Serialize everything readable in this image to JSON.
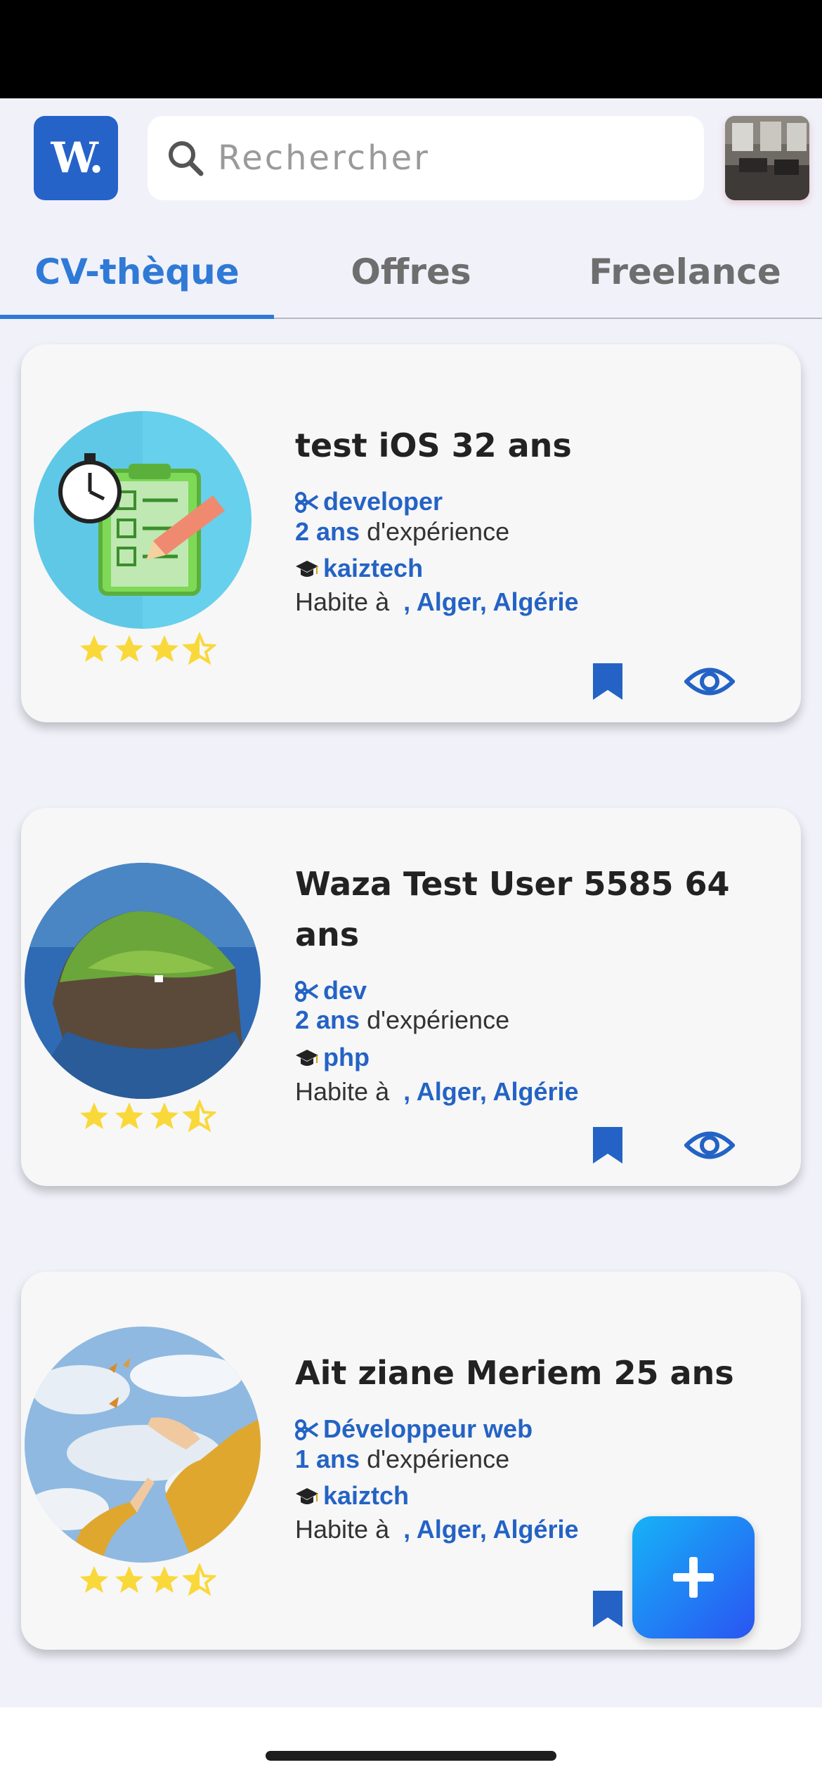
{
  "header": {
    "logo_text": "W.",
    "search_placeholder": "Rechercher"
  },
  "tabs": [
    {
      "label": "CV-thèque",
      "active": true
    },
    {
      "label": "Offres",
      "active": false
    },
    {
      "label": "Freelance",
      "active": false
    }
  ],
  "cards": [
    {
      "name": "test iOS 32 ans",
      "job": "developer",
      "experience_value": "2 ans",
      "experience_suffix": "d'expérience",
      "school": "kaiztech",
      "lives_prefix": "Habite à",
      "location": ", Alger, Algérie",
      "rating": 3.5
    },
    {
      "name": "Waza Test User 5585 64 ans",
      "job": "dev",
      "experience_value": "2 ans",
      "experience_suffix": "d'expérience",
      "school": "php",
      "lives_prefix": "Habite à",
      "location": ", Alger, Algérie",
      "rating": 3.5
    },
    {
      "name": "Ait ziane Meriem 25 ans",
      "job": "Développeur web",
      "experience_value": "1 ans",
      "experience_suffix": "d'expérience",
      "school": "kaiztch",
      "lives_prefix": "Habite à",
      "location": ", Alger, Algérie",
      "rating": 3.5
    }
  ],
  "colors": {
    "accent": "#2f7ad6",
    "link_blue": "#2463c5",
    "star": "#f9d83a",
    "background": "#f1f1fa"
  },
  "icons": [
    "search-icon",
    "scissors-icon",
    "graduation-cap-icon",
    "bookmark-icon",
    "eye-icon",
    "plus-icon",
    "star-icon"
  ]
}
